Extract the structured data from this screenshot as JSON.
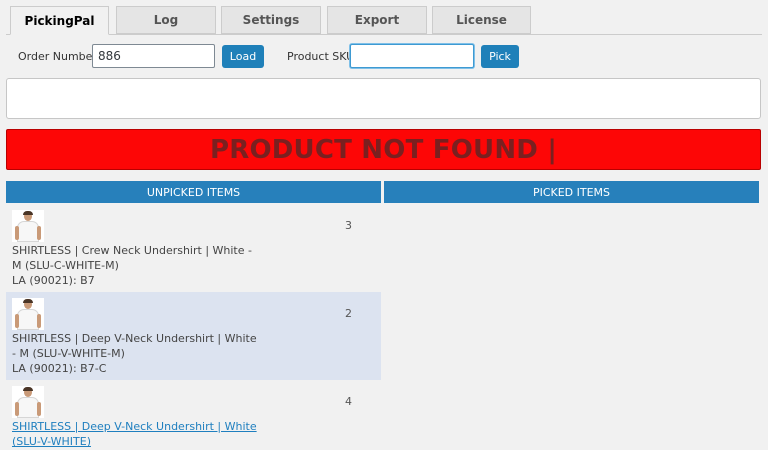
{
  "tabs": [
    {
      "label": "PickingPal",
      "active": true
    },
    {
      "label": "Log",
      "active": false
    },
    {
      "label": "Settings",
      "active": false
    },
    {
      "label": "Export",
      "active": false
    },
    {
      "label": "License",
      "active": false
    }
  ],
  "form": {
    "order_label": "Order Number",
    "order_value": "886",
    "load_label": "Load",
    "sku_label": "Product SKU",
    "sku_value": "",
    "pick_label": "Pick"
  },
  "message": "",
  "alert": {
    "text": "PRODUCT NOT FOUND |",
    "color": "#fd0606"
  },
  "columns": {
    "unpicked": "UNPICKED ITEMS",
    "picked": "PICKED ITEMS"
  },
  "unpicked_items": [
    {
      "qty": "3",
      "name": "SHIRTLESS | Crew Neck Undershirt | White - M (SLU-C-WHITE-M)",
      "location": "LA (90021): B7",
      "highlighted": false,
      "linked": false
    },
    {
      "qty": "2",
      "name": "SHIRTLESS | Deep V-Neck Undershirt | White - M (SLU-V-WHITE-M)",
      "location": "LA (90021): B7-C",
      "highlighted": true,
      "linked": false
    },
    {
      "qty": "4",
      "name": "SHIRTLESS | Deep V-Neck Undershirt | White (SLU-V-WHITE)",
      "location": "",
      "highlighted": false,
      "linked": true
    }
  ],
  "picked_items": [],
  "colors": {
    "accent": "#2780bb",
    "button": "#1f80b9",
    "highlight_row": "#dce3f0"
  }
}
